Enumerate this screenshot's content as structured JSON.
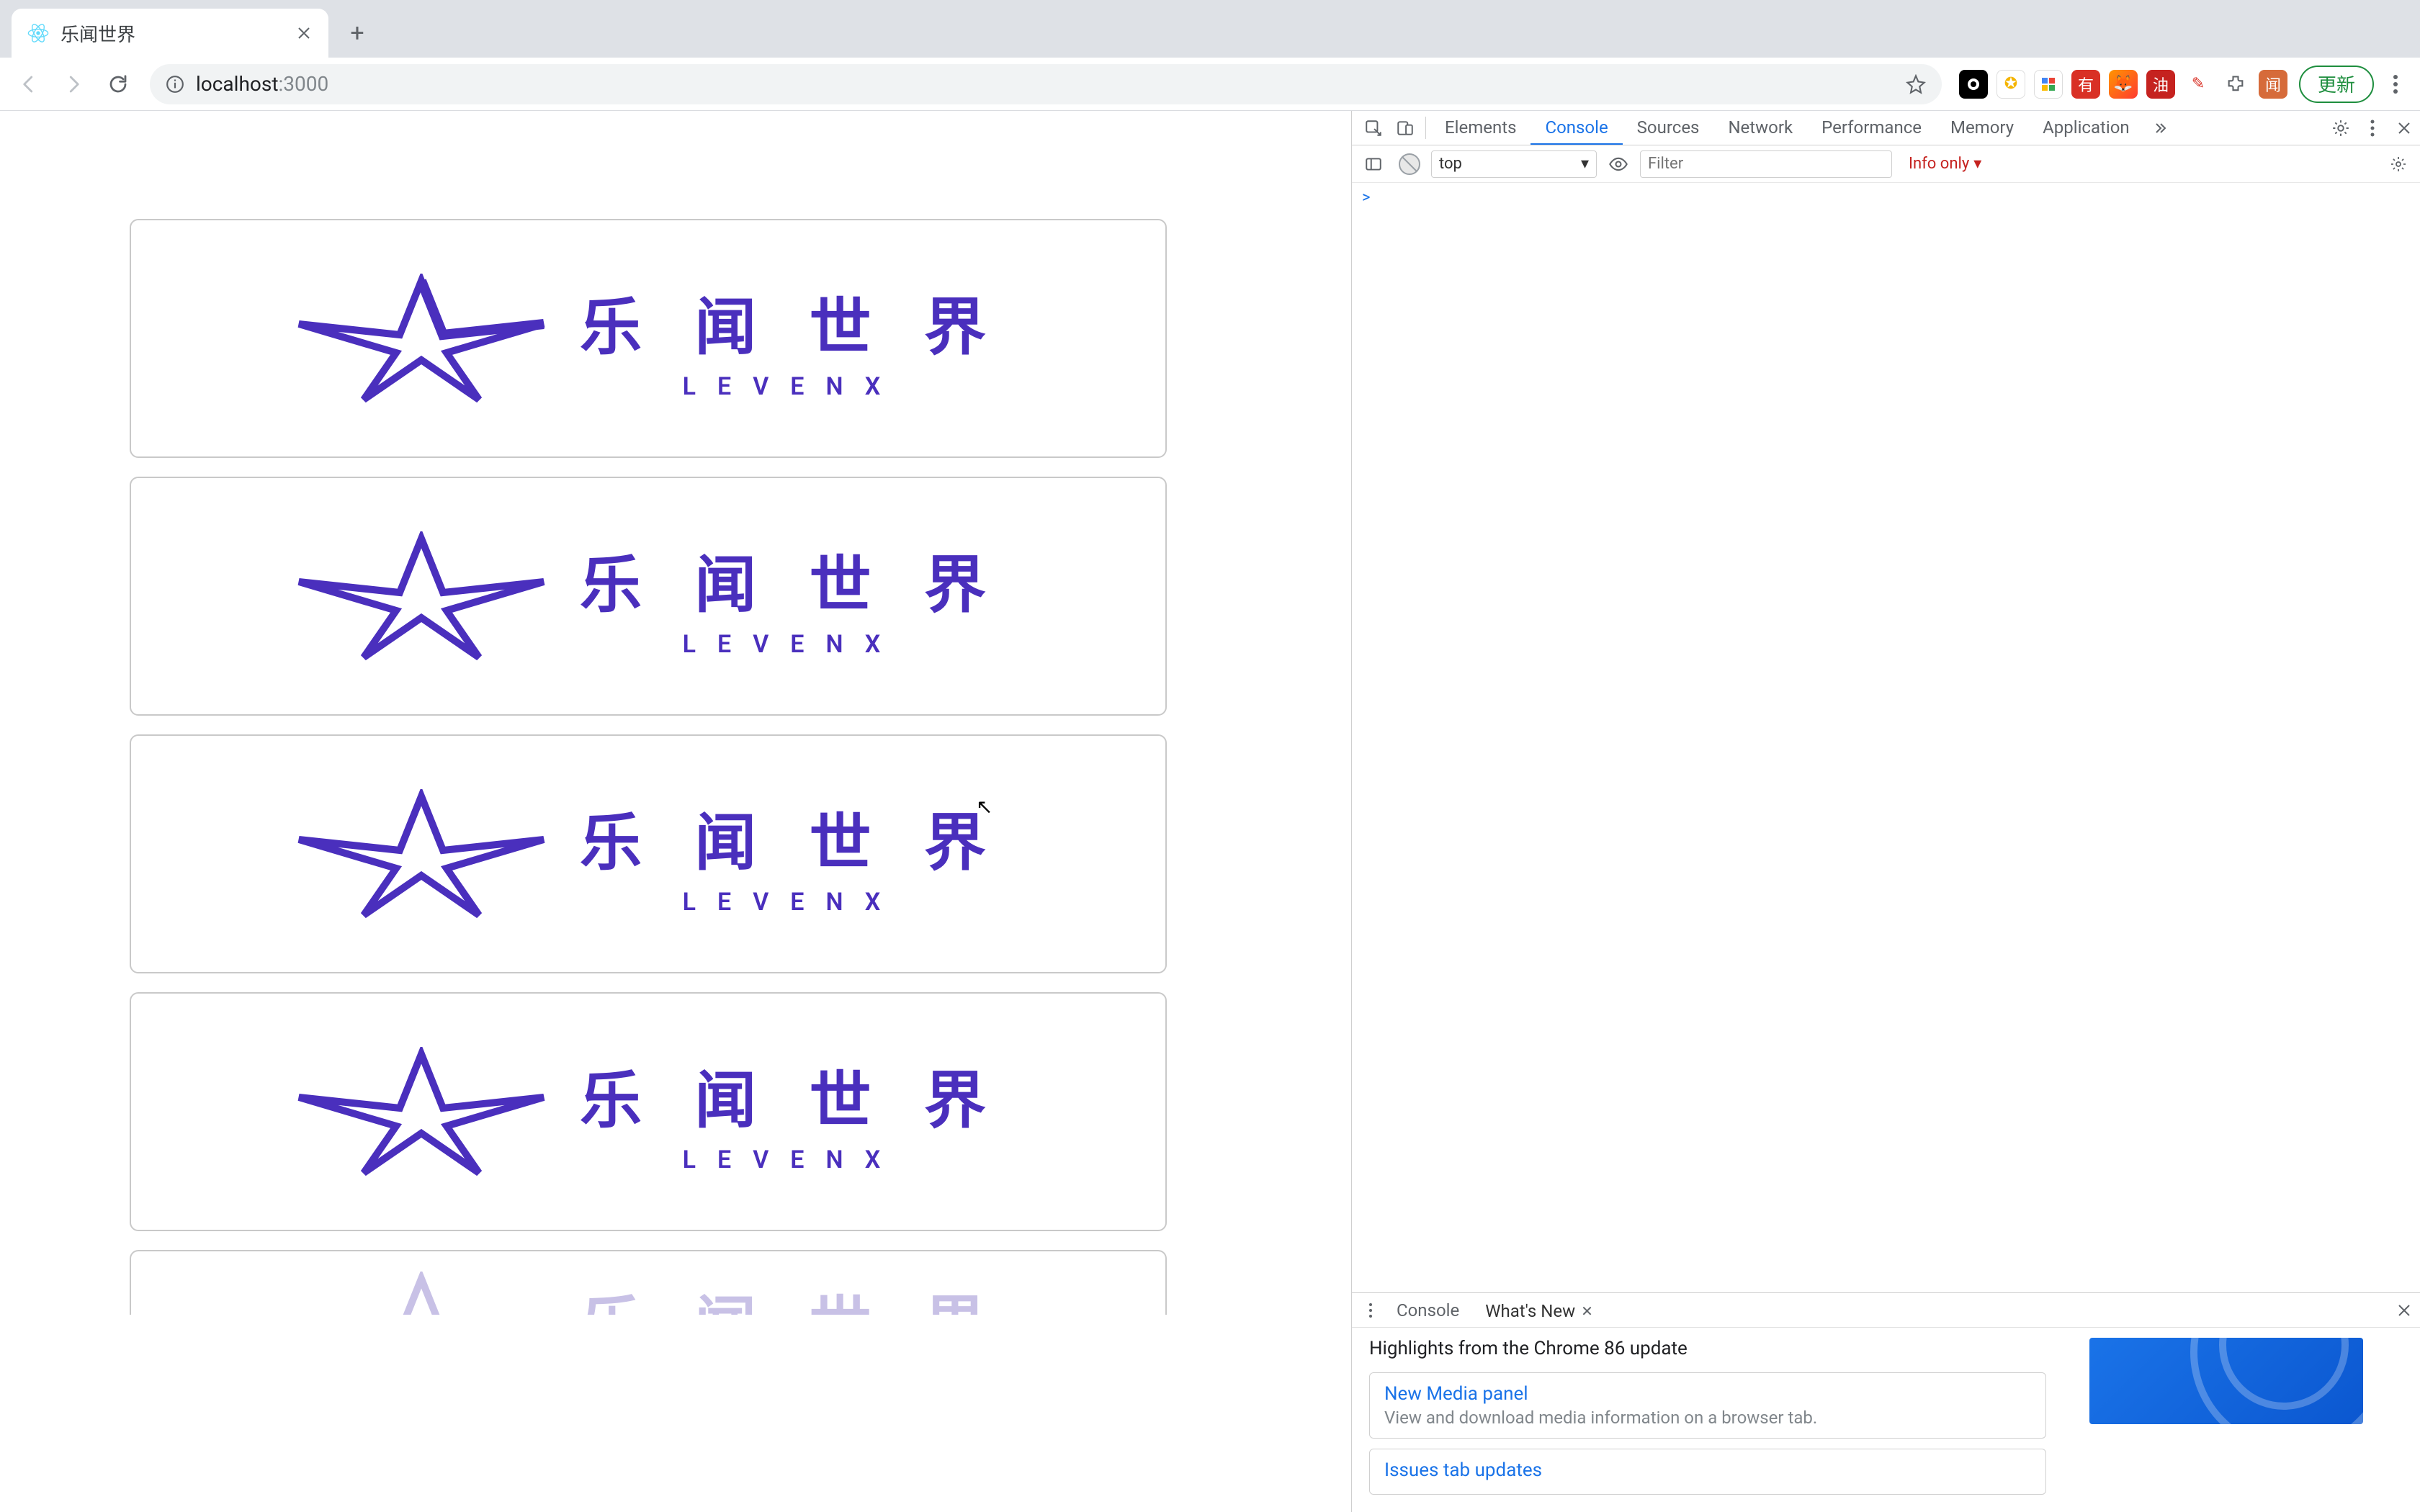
{
  "browser": {
    "tab": {
      "title": "乐闻世界"
    },
    "url": {
      "host": "localhost",
      "port": ":3000"
    },
    "update_label": "更新"
  },
  "page": {
    "logo": {
      "cn": "乐 闻 世 界",
      "en": "LEVENX"
    },
    "card_count": 5
  },
  "devtools": {
    "tabs": [
      "Elements",
      "Console",
      "Sources",
      "Network",
      "Performance",
      "Memory",
      "Application"
    ],
    "active_tab": "Console",
    "console": {
      "context": "top",
      "filter_placeholder": "Filter",
      "level": "Info only",
      "prompt": ">"
    }
  },
  "drawer": {
    "tabs": {
      "console": "Console",
      "whats_new": "What's New"
    },
    "heading": "Highlights from the Chrome 86 update",
    "cards": [
      {
        "title": "New Media panel",
        "desc": "View and download media information on a browser tab."
      },
      {
        "title": "Issues tab updates",
        "desc": ""
      }
    ]
  }
}
